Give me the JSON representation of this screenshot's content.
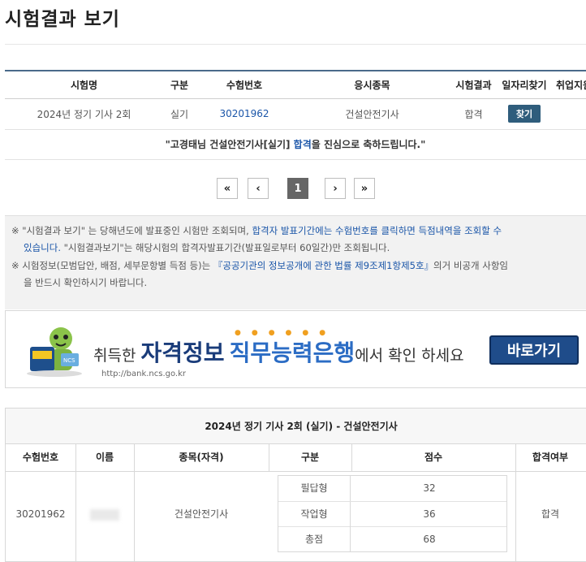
{
  "page": {
    "title": "시험결과 보기"
  },
  "result_table": {
    "headers": [
      "시험명",
      "구분",
      "수험번호",
      "응시종목",
      "시험결과",
      "일자리찾기",
      "취업지원"
    ],
    "row": {
      "exam_name": "2024년 정기 기사 2회",
      "type": "실기",
      "exam_number": "30201962",
      "subject": "건설안전기사",
      "result": "합격",
      "find_button": "찾기"
    },
    "congrats": {
      "prefix": "\"고경태님 건설안전기사[실기] ",
      "pass": "합격",
      "suffix": "을 진심으로 축하드립니다.\""
    }
  },
  "pagination": {
    "first": "«",
    "prev": "‹",
    "current": "1",
    "next": "›",
    "last": "»"
  },
  "notice": {
    "line1_a": "※ \"시험결과 보기\" 는 당해년도에 발표중인 시험만 조회되며, ",
    "line1_blue": "합격자 발표기간에는 수험번호를 클릭하면 득점내역을 조회할 수",
    "line2_blue": "있습니다.",
    "line2_b": " \"시험결과보기\"는 해당시험의 합격자발표기간(발표일로부터 60일간)만 조회됩니다.",
    "line3_a": "※ 시험정보(모범답안, 배점, 세부문항별 득점 등)는 ",
    "line3_blue": "『공공기관의 정보공개에 관한 법률 제9조제1항제5호』",
    "line3_b": "의거 비공개 사항임",
    "line4": "을 반드시 확인하시기 바랍니다."
  },
  "banner": {
    "lead": "취득한 ",
    "big1": "자격정보",
    "big2": "직무능력은행",
    "tail": "에서 확인 하세요",
    "url": "http://bank.ncs.go.kr",
    "button": "바로가기"
  },
  "detail": {
    "title": "2024년 정기 기사 2회 (실기) - 건설안전기사",
    "headers": [
      "수험번호",
      "이름",
      "종목(자격)",
      "구분",
      "점수",
      "합격여부"
    ],
    "exam_number": "30201962",
    "subject": "건설안전기사",
    "scores": [
      {
        "label": "필답형",
        "value": "32"
      },
      {
        "label": "작업형",
        "value": "36"
      },
      {
        "label": "총점",
        "value": "68"
      }
    ],
    "result": "합격"
  }
}
